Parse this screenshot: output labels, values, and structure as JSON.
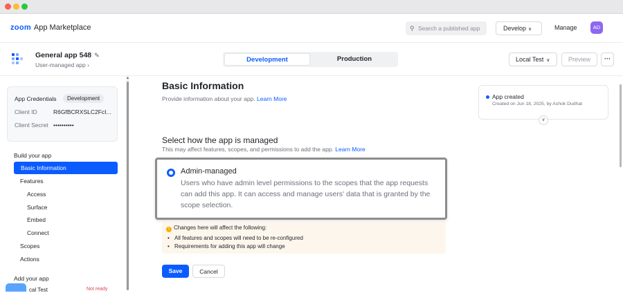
{
  "topnav": {
    "brand_zoom": "zoom",
    "brand_rest": "App Marketplace",
    "search_placeholder": "Search a published app",
    "develop_label": "Develop",
    "manage_label": "Manage",
    "avatar_initials": "AD"
  },
  "app": {
    "name": "General app 548",
    "subtitle": "User-managed app",
    "tabs": [
      {
        "label": "Development",
        "active": true
      },
      {
        "label": "Production",
        "active": false
      }
    ],
    "local_test_label": "Local Test",
    "preview_label": "Preview",
    "more_label": "···"
  },
  "sidebar": {
    "credentials": {
      "title": "App Credentials",
      "badge": "Development",
      "client_id_label": "Client ID",
      "client_id_value": "R6GfBCRXSLC2FcI...",
      "client_secret_label": "Client Secret",
      "client_secret_value": "••••••••••"
    },
    "build_heading": "Build your app",
    "items": [
      {
        "label": "Basic Information",
        "active": true
      },
      {
        "label": "Features"
      },
      {
        "label": "Access"
      },
      {
        "label": "Surface"
      },
      {
        "label": "Embed"
      },
      {
        "label": "Connect"
      },
      {
        "label": "Scopes"
      },
      {
        "label": "Actions"
      }
    ],
    "add_heading": "Add your app",
    "partial_item": "cal Test",
    "partial_badge": "Not ready"
  },
  "main": {
    "title": "Basic Information",
    "description": "Provide information about your app.",
    "learn_more": "Learn More",
    "select_title": "Select how the app is managed",
    "select_desc": "This may affect features, scopes, and permissions to add the app.",
    "option": {
      "title": "Admin-managed",
      "description": "Users who have admin level permissions to the scopes that the app requests can add this app. It can access and manage users' data that is granted by the scope selection.",
      "selected": true
    },
    "warning": {
      "title": "Changes here will affect the following:",
      "items": [
        "All features and scopes will need to be re-configured",
        "Requirements for adding this app will change"
      ]
    },
    "save_label": "Save",
    "cancel_label": "Cancel"
  },
  "activity": {
    "title": "App created",
    "subtitle": "Created on Jun 18, 2025, by Ashok Dudhat"
  },
  "colors": {
    "accent": "#0b5cff",
    "avatar": "#8e67f0",
    "warning_bg": "#fdf6ec"
  }
}
